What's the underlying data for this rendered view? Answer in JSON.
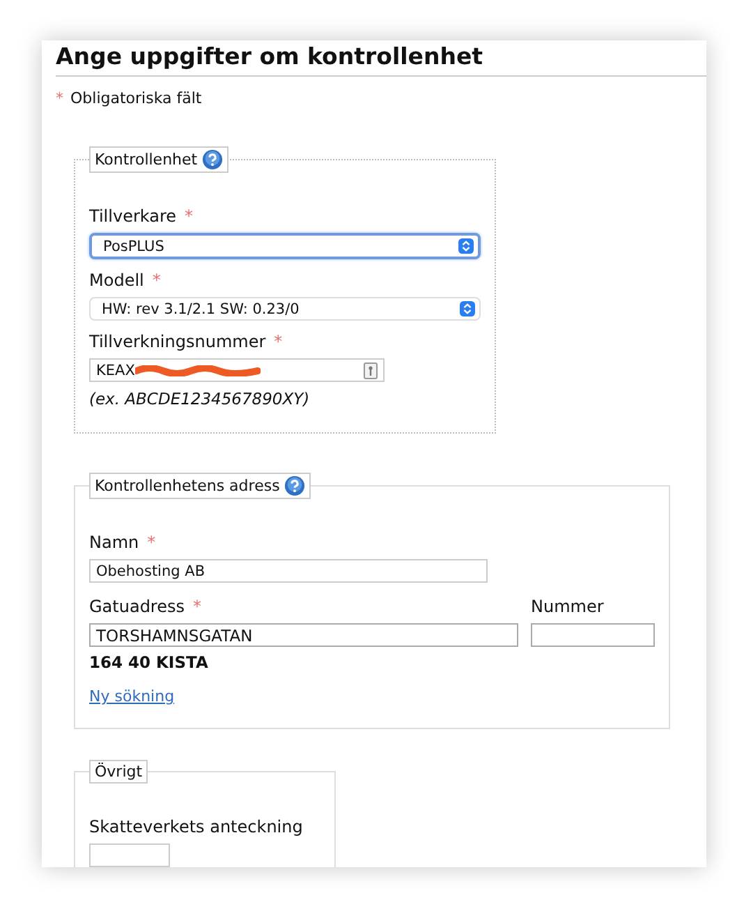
{
  "title": "Ange uppgifter om kontrollenhet",
  "required_note": {
    "mark": "*",
    "text": "Obligatoriska fält"
  },
  "sections": [
    {
      "legend": "Kontrollenhet",
      "help": true,
      "fields": [
        {
          "kind": "select",
          "label": "Tillverkare",
          "required": true,
          "mark": "*",
          "value": "PosPLUS",
          "focused": true
        },
        {
          "kind": "select",
          "label": "Modell",
          "required": true,
          "mark": "*",
          "value": "HW: rev 3.1/2.1 SW: 0.23/0",
          "focused": false
        },
        {
          "kind": "serial",
          "label": "Tillverkningsnummer",
          "required": true,
          "mark": "*",
          "value": "KEAX",
          "redacted": true,
          "hint": "(ex. ABCDE1234567890XY)"
        }
      ]
    },
    {
      "legend": "Kontrollenhetens adress",
      "help": true,
      "fields": [
        {
          "kind": "text",
          "label": "Namn",
          "required": true,
          "mark": "*",
          "value": "Obehosting AB"
        },
        {
          "kind": "street",
          "label": "Gatuadress",
          "required": true,
          "mark": "*",
          "value": "TORSHAMNSGATAN",
          "number_label": "Nummer"
        },
        {
          "kind": "postal",
          "value": "164 40 KISTA"
        },
        {
          "kind": "link",
          "label": "Ny sökning"
        }
      ]
    },
    {
      "legend": "Övrigt",
      "help": false,
      "fields": [
        {
          "kind": "note",
          "label": "Skatteverkets anteckning",
          "required": false
        }
      ]
    }
  ]
}
